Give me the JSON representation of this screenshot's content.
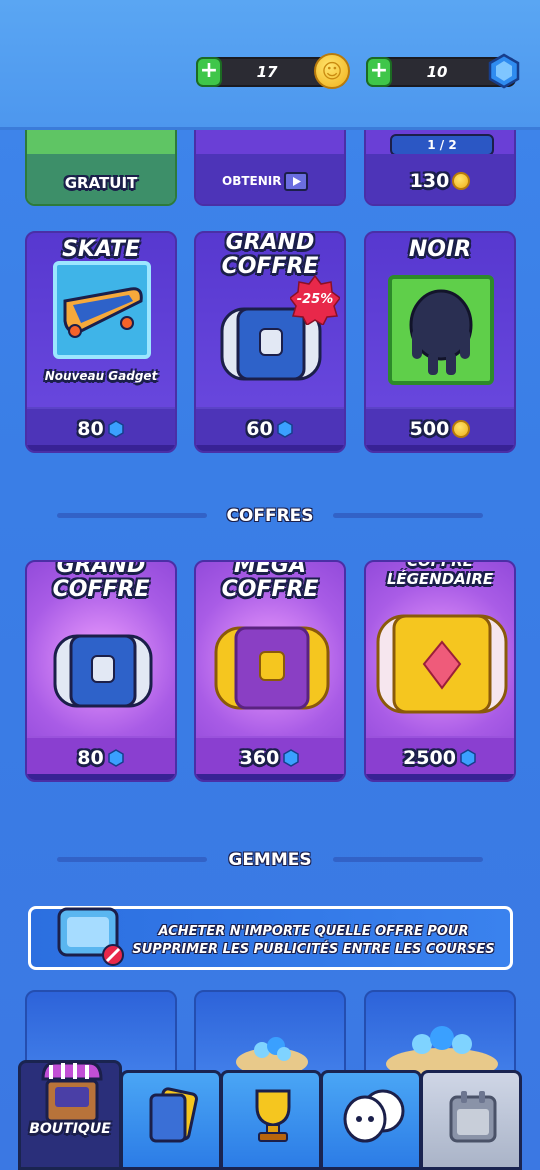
{
  "header": {
    "coins": "17",
    "gems": "10"
  },
  "top_row": {
    "gratuit": "GRATUIT",
    "obtenir": "OBTENIR",
    "price3": "130",
    "progress": "1 / 2"
  },
  "offers": [
    {
      "title": "SKATE",
      "subtitle": "Nouveau Gadget",
      "price": "80",
      "currency": "gem"
    },
    {
      "title": "GRAND COFFRE",
      "badge": "-25%",
      "price": "60",
      "currency": "gem"
    },
    {
      "title": "NOIR",
      "price": "500",
      "currency": "coin"
    }
  ],
  "sections": {
    "coffres": "COFFRES",
    "gemmes": "GEMMES"
  },
  "chests": [
    {
      "title": "GRAND COFFRE",
      "price": "80"
    },
    {
      "title": "MÉGA COFFRE",
      "price": "360"
    },
    {
      "title": "COFFRE LÉGENDAIRE",
      "price": "2500"
    }
  ],
  "ad": {
    "text": "ACHETER N'IMPORTE QUELLE OFFRE POUR SUPPRIMER LES PUBLICITÉS ENTRE LES COURSES"
  },
  "nav": {
    "boutique": "BOUTIQUE"
  },
  "colors": {
    "accent": "#3b7ee6",
    "card_purple": "#6a3fd6",
    "gem": "#3aa0ff",
    "coin": "#f0b11b",
    "badge_red": "#e8284a"
  }
}
